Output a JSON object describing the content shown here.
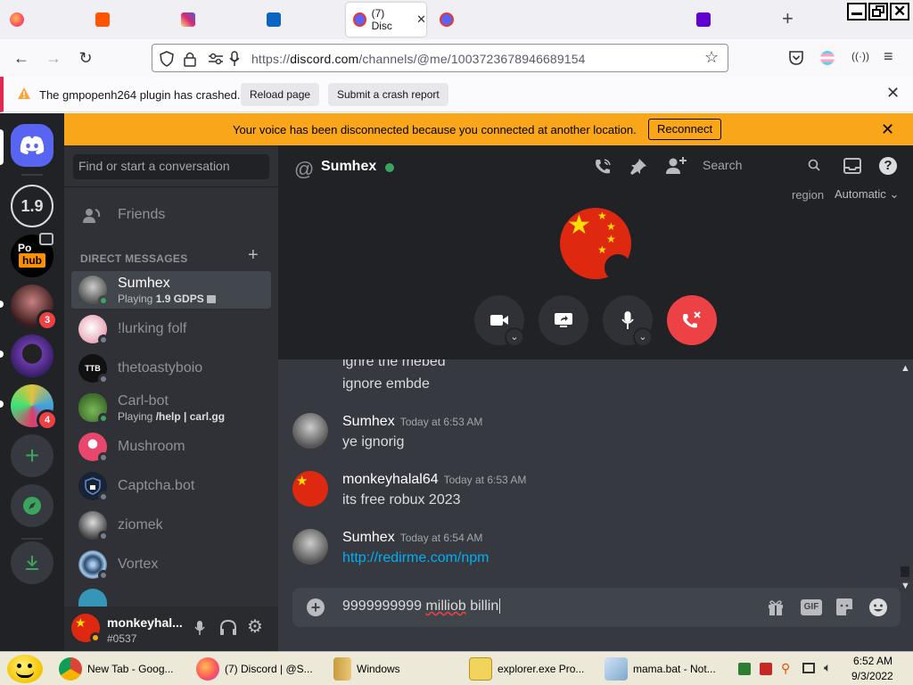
{
  "browser": {
    "active_tab_title": "(7) Disc",
    "new_tab_symbol": "+",
    "url_prefix": "https://",
    "url_domain": "discord.com",
    "url_path": "/channels/@me/1003723678946689154"
  },
  "crash": {
    "message": "The gmpopenh264 plugin has crashed.",
    "reload_label": "Reload page",
    "report_label": "Submit a crash report"
  },
  "voice_banner": {
    "message": "Your voice has been disconnected because you connected at another location.",
    "reconnect_label": "Reconnect"
  },
  "servers": {
    "version_label": "1.9",
    "badge_a": "3",
    "badge_b": "4"
  },
  "dm": {
    "search_placeholder": "Find or start a conversation",
    "friends_label": "Friends",
    "section_label": "DIRECT MESSAGES",
    "items": [
      {
        "name": "Sumhex",
        "sub_prefix": "Playing ",
        "sub_bold": "1.9 GDPS",
        "status": "online"
      },
      {
        "name": "!lurking folf",
        "status": "offline"
      },
      {
        "name": "thetoastyboio",
        "status": "offline"
      },
      {
        "name": "Carl-bot",
        "sub_prefix": "Playing ",
        "sub_bold": "/help | carl.gg",
        "status": "online"
      },
      {
        "name": "Mushroom",
        "status": "offline"
      },
      {
        "name": "Captcha.bot",
        "status": "offline"
      },
      {
        "name": "ziomek",
        "status": "offline"
      },
      {
        "name": "Vortex",
        "status": "offline"
      }
    ]
  },
  "user": {
    "name": "monkeyhal...",
    "tag": "#0537"
  },
  "channel": {
    "name": "Sumhex",
    "search_placeholder": "Search",
    "region_label": "region",
    "region_value": "Automatic"
  },
  "messages": {
    "partial_1": "ignre the mebed",
    "partial_2": "ignore embde",
    "groups": [
      {
        "author": "Sumhex",
        "time": "Today at 6:53 AM",
        "text": "ye ignorig"
      },
      {
        "author": "monkeyhalal64",
        "time": "Today at 6:53 AM",
        "text": "its free robux 2023"
      },
      {
        "author": "Sumhex",
        "time": "Today at 6:54 AM",
        "text": "http://redirme.com/npm"
      }
    ]
  },
  "composer": {
    "value_1": "9999999999 ",
    "value_2": "milliob",
    "value_3": "  billin"
  },
  "taskbar": {
    "items": [
      {
        "label": "New Tab - Goog..."
      },
      {
        "label": "(7) Discord | @S..."
      },
      {
        "label": "Windows"
      },
      {
        "label": "explorer.exe Pro..."
      },
      {
        "label": "mama.bat - Not..."
      }
    ],
    "time": "6:52 AM",
    "date": "9/3/2022"
  },
  "colors": {
    "discord_blurple": "#5865f2",
    "banner": "#faa61a",
    "hangup": "#ed4245",
    "link": "#00aff4",
    "online": "#3ba55d"
  }
}
